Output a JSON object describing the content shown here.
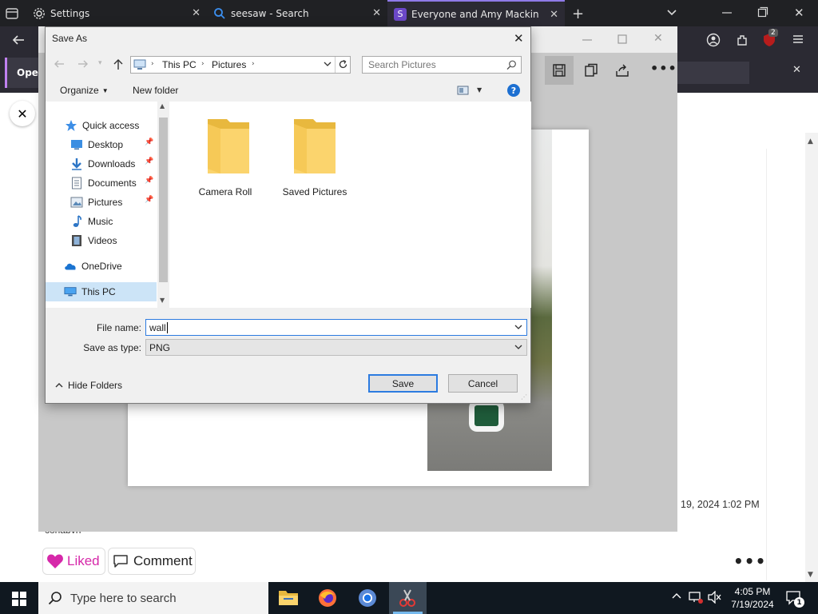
{
  "tabs": [
    {
      "label": "Settings",
      "icon": "gear-icon"
    },
    {
      "label": "seesaw - Search",
      "icon": "search-icon"
    },
    {
      "label": "Everyone and Amy Mackinnon's",
      "icon": "seesaw-icon"
    }
  ],
  "infobar": {
    "label": "Oper"
  },
  "post": {
    "timestamp": "19, 2024 1:02 PM",
    "partial_text": "conabvn",
    "liked_label": "Liked",
    "comment_label": "Comment"
  },
  "dialog": {
    "title": "Save As",
    "breadcrumb": [
      "This PC",
      "Pictures"
    ],
    "search_placeholder": "Search Pictures",
    "organize_label": "Organize",
    "new_folder_label": "New folder",
    "nav_items": [
      {
        "label": "Quick access",
        "icon": "star-icon",
        "pinned": false
      },
      {
        "label": "Desktop",
        "icon": "desktop-icon",
        "pinned": true
      },
      {
        "label": "Downloads",
        "icon": "download-icon",
        "pinned": true
      },
      {
        "label": "Documents",
        "icon": "document-icon",
        "pinned": true
      },
      {
        "label": "Pictures",
        "icon": "pictures-icon",
        "pinned": true
      },
      {
        "label": "Music",
        "icon": "music-icon",
        "pinned": false
      },
      {
        "label": "Videos",
        "icon": "video-icon",
        "pinned": false
      },
      {
        "label": "OneDrive",
        "icon": "cloud-icon",
        "pinned": false
      },
      {
        "label": "This PC",
        "icon": "computer-icon",
        "pinned": false
      }
    ],
    "folders": [
      "Camera Roll",
      "Saved Pictures"
    ],
    "file_name_label": "File name:",
    "file_name_value": "wall",
    "save_type_label": "Save as type:",
    "save_type_value": "PNG",
    "hide_folders_label": "Hide Folders",
    "save_label": "Save",
    "cancel_label": "Cancel"
  },
  "taskbar": {
    "search_placeholder": "Type here to search",
    "time": "4:05 PM",
    "date": "7/19/2024",
    "notification_count": "1"
  },
  "extension_badge": "2"
}
